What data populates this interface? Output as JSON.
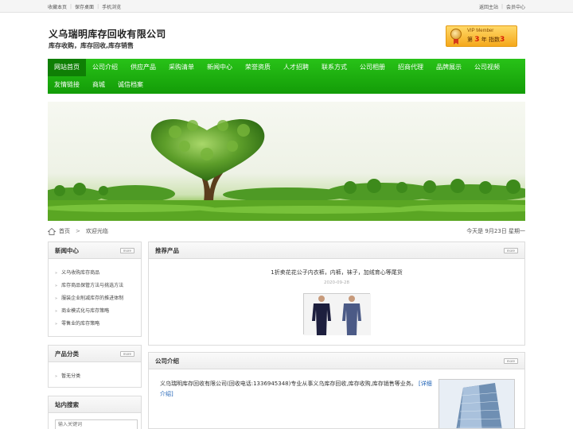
{
  "topbar": {
    "left_links": [
      "收藏本页",
      "保存桌面",
      "手机浏览"
    ],
    "right_links": [
      "返回主站",
      "会员中心"
    ]
  },
  "header": {
    "company_name": "义乌瑞明库存回收有限公司",
    "slogan": "库存收购，库存回收,库存销售",
    "vip": {
      "title": "VIP Member",
      "prefix": "第",
      "years": "3",
      "year_unit": "年",
      "index_label": "指数",
      "index_value": "3"
    }
  },
  "nav": {
    "items": [
      "网站首页",
      "公司介绍",
      "供应产品",
      "采购清单",
      "新闻中心",
      "荣誉资质",
      "人才招聘",
      "联系方式",
      "公司相册",
      "招商代理",
      "品牌展示",
      "公司视频",
      "友情链接",
      "商城",
      "诚信档案"
    ],
    "active_index": 0
  },
  "breadcrumb": {
    "home": "首页",
    "separator": ">",
    "current": "欢迎光临",
    "date": "今天是  9月23日 星期一"
  },
  "sidebar": {
    "news": {
      "title": "新闻中心",
      "more": "more",
      "items": [
        "义乌收购库存商品",
        "库存商品保管方法与挑选方法",
        "服装企业削减库存的推进体制",
        "商业模式化与库存策略",
        "零售业的库存策略"
      ]
    },
    "categories": {
      "title": "产品分类",
      "more": "more",
      "items": [
        "暂无分类"
      ]
    },
    "search": {
      "title": "站内搜索",
      "placeholder": "输入关键词"
    }
  },
  "main": {
    "recommended": {
      "title": "推荐产品",
      "more": "more",
      "product_title": "1折卖花花公子内衣裤，内裤，袜子，加绒育心等尾货",
      "product_date": "2020-09-28"
    },
    "intro": {
      "title": "公司介绍",
      "more": "more",
      "text": "义乌瑞明库存回收有限公司(回收电话:13369453​48)专业从事义乌库存回收,库存收购,库存销售等业务。",
      "detail_link": "[详细介绍]"
    }
  },
  "colors": {
    "nav_green": "#1db60e",
    "nav_active": "#0f7f05",
    "link_blue": "#1a5fb4"
  }
}
